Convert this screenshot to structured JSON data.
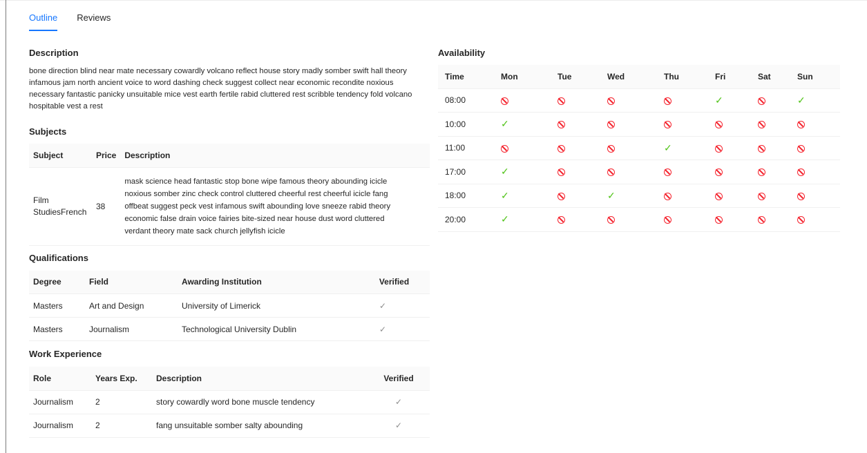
{
  "tabs": [
    {
      "label": "Outline",
      "active": true
    },
    {
      "label": "Reviews",
      "active": false
    }
  ],
  "description": {
    "title": "Description",
    "text": "bone direction blind near mate necessary cowardly volcano reflect house story madly somber swift hall theory infamous jam north ancient voice to word dashing check suggest collect near economic recondite noxious necessary fantastic panicky unsuitable mice vest earth fertile rabid cluttered rest scribble tendency fold volcano hospitable vest a rest"
  },
  "subjects": {
    "title": "Subjects",
    "columns": [
      "Subject",
      "Price",
      "Description"
    ],
    "rows": [
      {
        "subject": "Film StudiesFrench",
        "price": "38",
        "description": "mask science head fantastic stop bone wipe famous theory abounding icicle noxious somber zinc check control cluttered cheerful rest cheerful icicle fang offbeat suggest peck vest infamous swift abounding love sneeze rabid theory economic false drain voice fairies bite-sized near house dust word cluttered verdant theory mate sack church jellyfish icicle"
      }
    ]
  },
  "qualifications": {
    "title": "Qualifications",
    "columns": [
      "Degree",
      "Field",
      "Awarding Institution",
      "Verified"
    ],
    "rows": [
      {
        "degree": "Masters",
        "field": "Art and Design",
        "institution": "University of Limerick",
        "verified": "✓"
      },
      {
        "degree": "Masters",
        "field": "Journalism",
        "institution": "Technological University Dublin",
        "verified": "✓"
      }
    ]
  },
  "work_experience": {
    "title": "Work Experience",
    "columns": [
      "Role",
      "Years Exp.",
      "Description",
      "Verified"
    ],
    "rows": [
      {
        "role": "Journalism",
        "years": "2",
        "description": "story cowardly word bone muscle tendency",
        "verified": "✓"
      },
      {
        "role": "Journalism",
        "years": "2",
        "description": "fang unsuitable somber salty abounding",
        "verified": "✓"
      }
    ]
  },
  "availability": {
    "title": "Availability",
    "columns": [
      "Time",
      "Mon",
      "Tue",
      "Wed",
      "Thu",
      "Fri",
      "Sat",
      "Sun"
    ],
    "rows": [
      {
        "time": "08:00",
        "slots": [
          false,
          false,
          false,
          false,
          true,
          false,
          true
        ]
      },
      {
        "time": "10:00",
        "slots": [
          true,
          false,
          false,
          false,
          false,
          false,
          false
        ]
      },
      {
        "time": "11:00",
        "slots": [
          false,
          false,
          false,
          true,
          false,
          false,
          false
        ]
      },
      {
        "time": "17:00",
        "slots": [
          true,
          false,
          false,
          false,
          false,
          false,
          false
        ]
      },
      {
        "time": "18:00",
        "slots": [
          true,
          false,
          true,
          false,
          false,
          false,
          false
        ]
      },
      {
        "time": "20:00",
        "slots": [
          true,
          false,
          false,
          false,
          false,
          false,
          false
        ]
      }
    ],
    "available_icon": "check-icon",
    "unavailable_icon": "prohibited-icon",
    "colors": {
      "available": "#52c41a",
      "unavailable": "#f5222d"
    }
  },
  "colors": {
    "accent": "#1677ff",
    "header_bg": "#fafafa"
  }
}
